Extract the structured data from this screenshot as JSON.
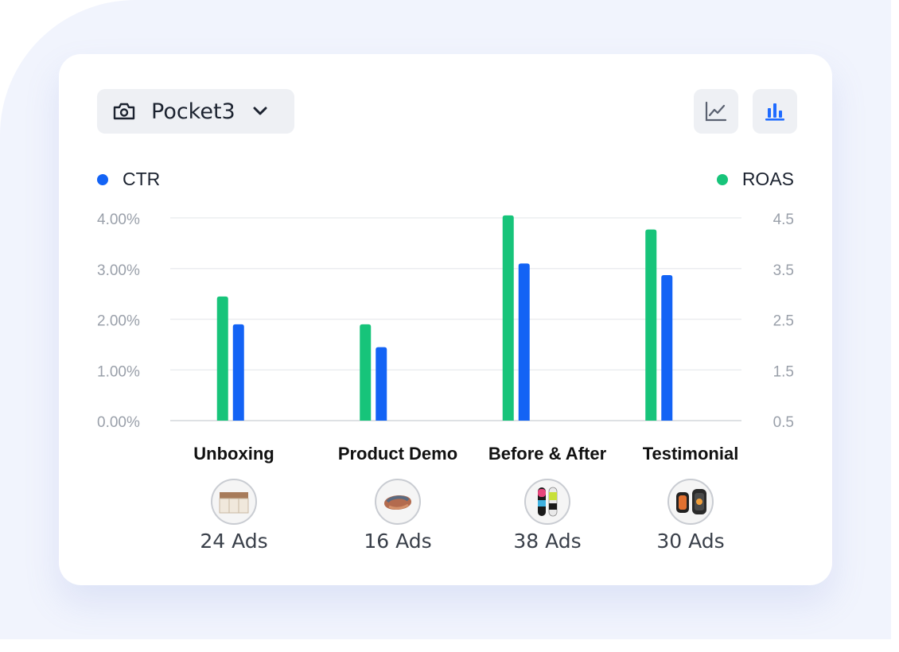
{
  "selector": {
    "device": "Pocket3",
    "icon": "camera-icon"
  },
  "view_toggle": {
    "line_icon": "line-chart-icon",
    "bar_icon": "bar-chart-icon",
    "active": "bar",
    "active_color": "#1f6bff",
    "inactive_color": "#5a6170"
  },
  "legend": {
    "left": {
      "label": "CTR",
      "color": "#1363f5"
    },
    "right": {
      "label": "ROAS",
      "color": "#17c47a"
    }
  },
  "categories": [
    {
      "label": "Unboxing",
      "ads": "24 Ads",
      "thumb": "storage-box-thumbnail"
    },
    {
      "label": "Product Demo",
      "ads": "16 Ads",
      "thumb": "scarf-thumbnail"
    },
    {
      "label": "Before & After",
      "ads": "38 Ads",
      "thumb": "skis-thumbnail"
    },
    {
      "label": "Testimonial",
      "ads": "30 Ads",
      "thumb": "smartwatch-thumbnail"
    }
  ],
  "chart_data": {
    "type": "bar",
    "categories": [
      "Unboxing",
      "Product Demo",
      "Before & After",
      "Testimonial"
    ],
    "series": [
      {
        "name": "ROAS",
        "axis": "right",
        "color": "#17c47a",
        "values": [
          2.95,
          2.4,
          4.55,
          4.27
        ]
      },
      {
        "name": "CTR",
        "axis": "left",
        "color": "#1363f5",
        "values": [
          1.9,
          1.45,
          3.1,
          2.87
        ]
      }
    ],
    "y_left": {
      "ticks": [
        "4.00%",
        "3.00%",
        "2.00%",
        "1.00%",
        "0.00%"
      ],
      "range": [
        0,
        4
      ]
    },
    "y_right": {
      "ticks": [
        "4.5",
        "3.5",
        "2.5",
        "1.5",
        "0.5"
      ],
      "range": [
        0.5,
        4.5
      ]
    },
    "grid": true,
    "legend": "top"
  }
}
